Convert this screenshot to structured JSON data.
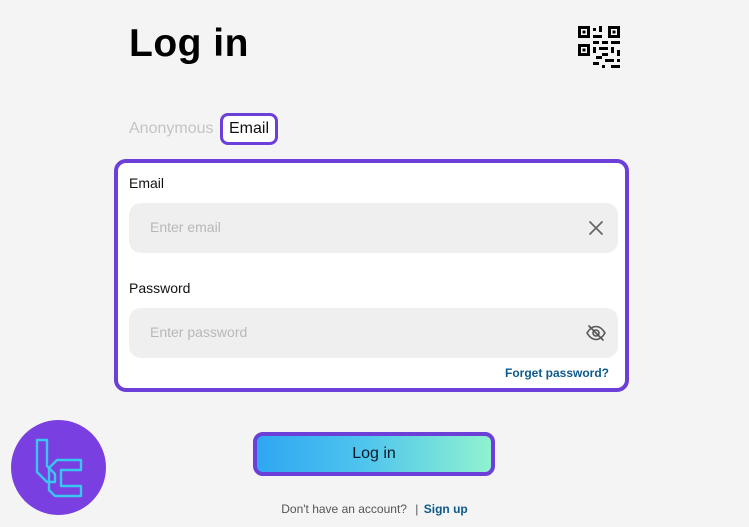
{
  "page": {
    "title": "Log in"
  },
  "header": {
    "qr_icon": "qr-code-icon"
  },
  "tabs": [
    {
      "label": "Anonymous",
      "active": false
    },
    {
      "label": "Email",
      "active": true
    }
  ],
  "form": {
    "email_label": "Email",
    "email_placeholder": "Enter email",
    "email_value": "",
    "password_label": "Password",
    "password_placeholder": "Enter password",
    "password_value": "",
    "forget_password": "Forget password?",
    "clear_icon": "close-icon",
    "visibility_icon": "eye-off-icon"
  },
  "actions": {
    "login_label": "Log in"
  },
  "footer": {
    "no_account_text": "Don't have an account?",
    "separator": "|",
    "signup_link": "Sign up"
  },
  "colors": {
    "accent": "#6b3fd8",
    "link": "#0d5b8c",
    "button_gradient_start": "#2ea7f2",
    "button_gradient_end": "#8ff2cf",
    "logo_bg": "#7a3fe0",
    "logo_mark": "#39c6f0"
  }
}
